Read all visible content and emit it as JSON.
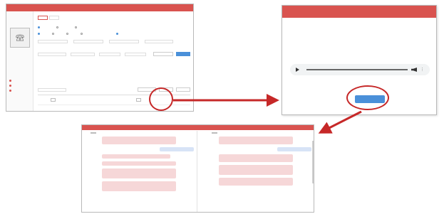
{
  "colors": {
    "accent": "#d9534f",
    "arrow": "#c62828",
    "button": "#4a90d9",
    "bubble_pink": "#f6d7d8",
    "bubble_blue": "#d7e3f6"
  },
  "list_screen": {
    "app_title": "",
    "header_links": [
      "",
      ""
    ],
    "page_title": "",
    "tabs": [
      "",
      ""
    ],
    "nav": [
      "",
      "",
      ""
    ],
    "filter": {
      "search_label": ""
    },
    "table": {
      "headers": [
        "",
        "",
        "",
        "",
        "",
        ""
      ]
    }
  },
  "detail_modal": {
    "title": "",
    "rows": [
      {
        "key": "",
        "value": ""
      },
      {
        "key": "",
        "value": ""
      },
      {
        "key": "",
        "value": ""
      },
      {
        "key": "",
        "value": ""
      }
    ],
    "player": {
      "time": "",
      "play_icon": "play-icon",
      "volume_icon": "volume-icon",
      "more_icon": "more-vertical-icon"
    },
    "download_button": ""
  },
  "transcript": {
    "title": "",
    "left_head": {
      "label": "",
      "select": ""
    },
    "right_head": {
      "label1": "",
      "label2": "",
      "select": ""
    },
    "left_messages": [
      {
        "speaker": "",
        "time": "",
        "text": "",
        "side": "pink"
      },
      {
        "speaker": "",
        "time": "",
        "text": "",
        "side": "blue"
      },
      {
        "speaker": "",
        "time": "",
        "text": "",
        "side": "pink"
      },
      {
        "speaker": "",
        "time": "",
        "text": "",
        "side": "pink"
      },
      {
        "speaker": "",
        "time": "",
        "text": "",
        "side": "pink"
      }
    ],
    "right_messages": [
      {
        "speaker": "",
        "time": "",
        "text": "",
        "side": "pink"
      },
      {
        "speaker": "",
        "time": "",
        "text": "",
        "side": "blue"
      },
      {
        "speaker": "",
        "time": "",
        "text": "",
        "side": "pink"
      },
      {
        "speaker": "",
        "time": "",
        "text": "",
        "side": "pink"
      },
      {
        "speaker": "",
        "time": "",
        "text": "",
        "side": "pink"
      }
    ]
  }
}
